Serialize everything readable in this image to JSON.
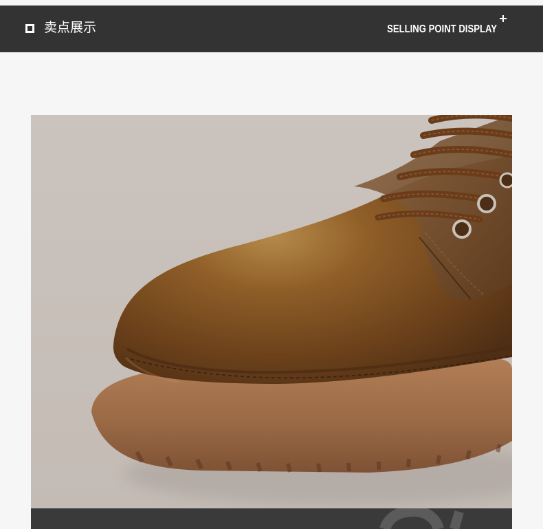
{
  "header": {
    "title_cn": "卖点展示",
    "title_en": "SELLING POINT DISPLAY"
  },
  "colors": {
    "top_bar": "#333333",
    "page_bg": "#f6f6f6",
    "photo_bg": "#c8bfb9",
    "boot_leather": "#7b4f22",
    "sole": "#9b6b46",
    "bottom_band": "#3a3a3a"
  },
  "icons": {
    "square": "square-outline-icon",
    "plus": "plus-icon"
  },
  "photo": {
    "subject": "boot-image"
  }
}
